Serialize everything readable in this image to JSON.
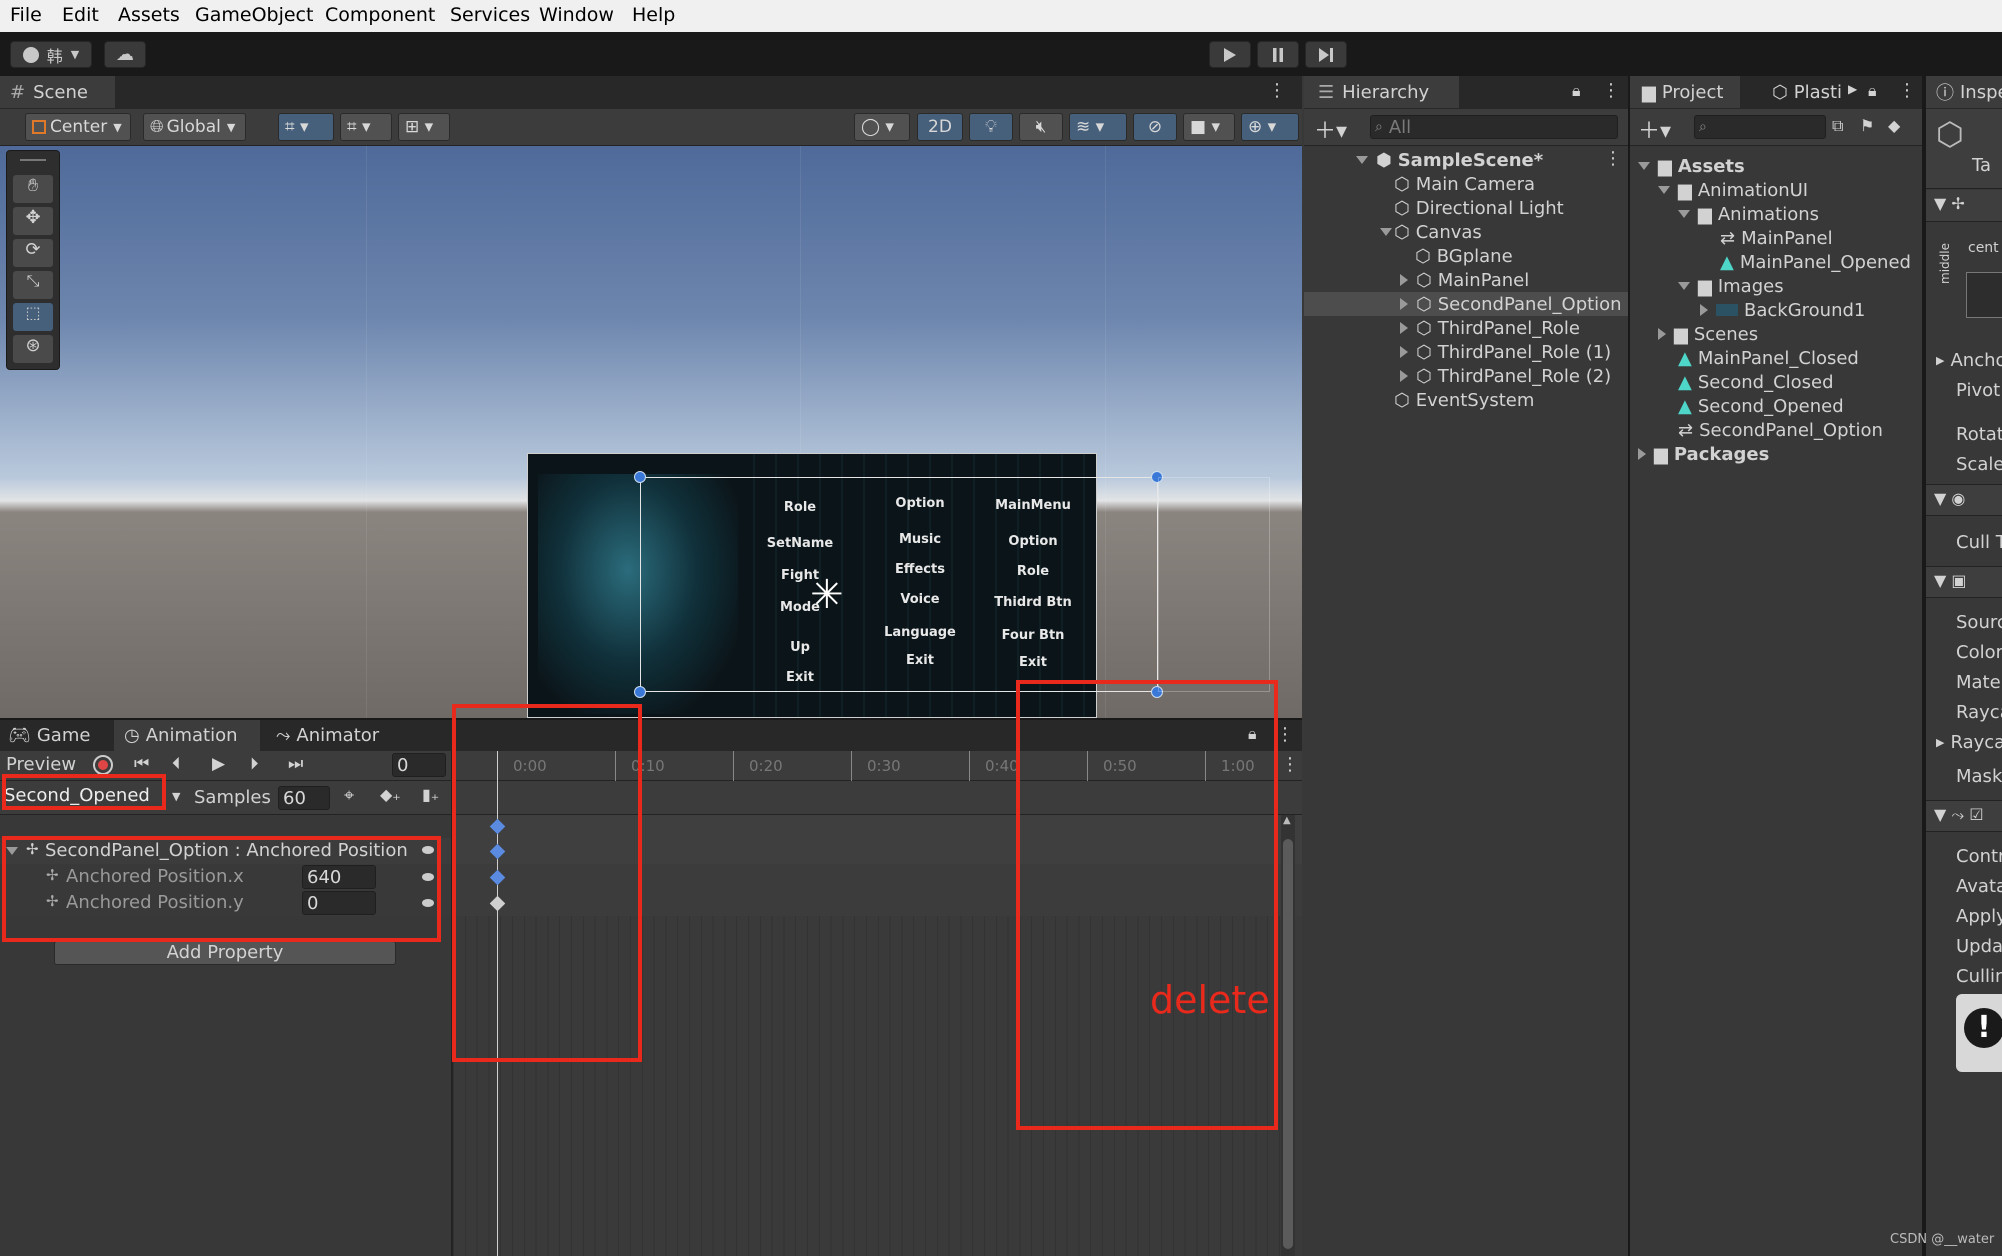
{
  "menu": [
    "File",
    "Edit",
    "Assets",
    "GameObject",
    "Component",
    "Services",
    "Window",
    "Help"
  ],
  "toolbar": {
    "account_label": "韩"
  },
  "scene": {
    "tab": "Scene",
    "pivot": "Center",
    "space": "Global",
    "mode_2d": "2D"
  },
  "ui_preview": {
    "col1": [
      "Role",
      "SetName",
      "Fight",
      "Mode",
      "Up",
      "Exit"
    ],
    "col2": [
      "Option",
      "Music",
      "Effects",
      "Voice",
      "Language",
      "Exit"
    ],
    "col3": [
      "MainMenu",
      "Option",
      "Role",
      "Thidrd Btn",
      "Four Btn",
      "Exit"
    ]
  },
  "hierarchy": {
    "tab": "Hierarchy",
    "search_placeholder": "All",
    "scene": "SampleScene*",
    "items": [
      "Main Camera",
      "Directional Light",
      "Canvas",
      "BGplane",
      "MainPanel",
      "SecondPanel_Option",
      "ThirdPanel_Role",
      "ThirdPanel_Role (1)",
      "ThirdPanel_Role (2)",
      "EventSystem"
    ]
  },
  "project": {
    "tab": "Project",
    "tab2": "Plasti",
    "items": [
      "Assets",
      "AnimationUI",
      "Animations",
      "MainPanel",
      "MainPanel_Opened",
      "Images",
      "BackGround1",
      "Scenes",
      "MainPanel_Closed",
      "Second_Closed",
      "Second_Opened",
      "SecondPanel_Option",
      "Packages"
    ]
  },
  "inspector": {
    "tab": "Inspe",
    "labels": [
      "Ta",
      "cent",
      "middle",
      "Ancho",
      "Pivot",
      "Rotati",
      "Scale",
      "Cull T",
      "Sourc",
      "Color",
      "Mater",
      "Rayca",
      "Rayca",
      "Mask",
      "Contr",
      "Avata",
      "Apply",
      "Upda",
      "Cullin"
    ]
  },
  "bottom_tabs": [
    "Game",
    "Animation",
    "Animator"
  ],
  "animation": {
    "preview": "Preview",
    "frame": "0",
    "clip": "Second_Opened",
    "samples_label": "Samples",
    "samples": "60",
    "property": "SecondPanel_Option : Anchored Position",
    "x_label": "Anchored Position.x",
    "x_value": "640",
    "y_label": "Anchored Position.y",
    "y_value": "0",
    "add_property": "Add Property",
    "ticks": [
      "0:00",
      "0:10",
      "0:20",
      "0:30",
      "0:40",
      "0:50",
      "1:00"
    ]
  },
  "annotation": {
    "text": "delete",
    "color": "#e8291c"
  },
  "watermark": "CSDN @__water"
}
